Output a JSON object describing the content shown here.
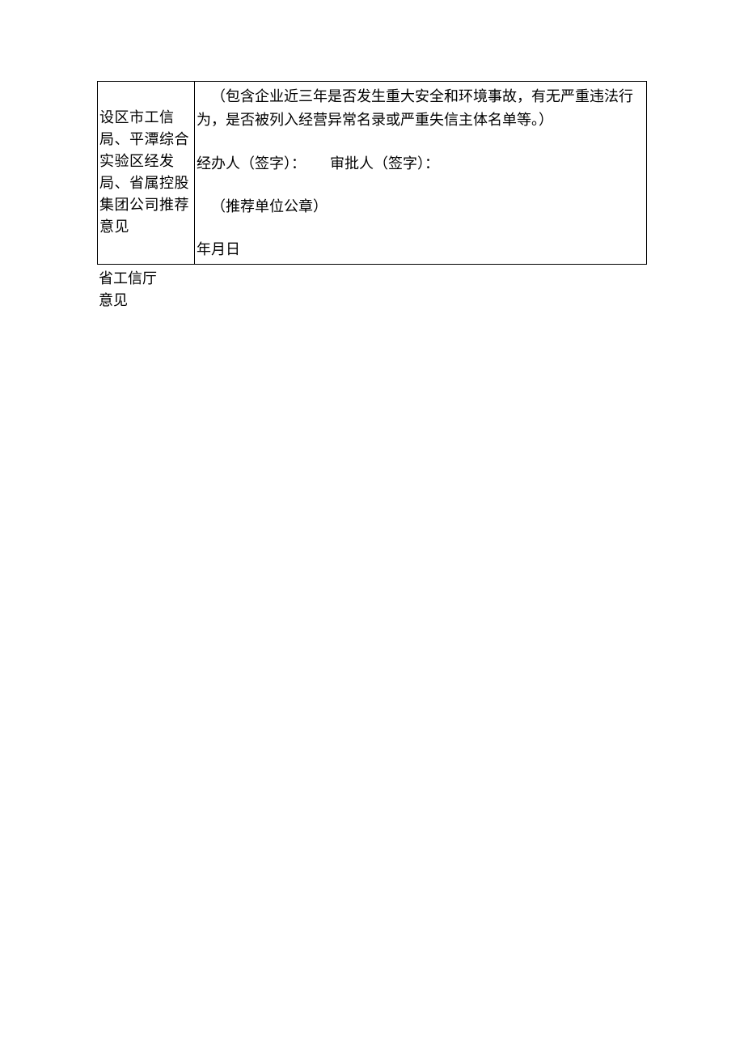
{
  "table": {
    "row1": {
      "left": "设区市工信局、平潭综合实验区经发局、省属控股集团公司推荐意见",
      "note": "（包含企业近三年是否发生重大安全和环境事故，有无严重违法行为，是否被列入经营异常名录或严重失信主体名单等。）",
      "handler_label": "经办人（签字）：",
      "approver_label": "审批人（签字）：",
      "stamp_label": "（推荐单位公章）",
      "date_label": "年月日"
    }
  },
  "below": {
    "line1": "省工信厅",
    "line2": "意见"
  }
}
